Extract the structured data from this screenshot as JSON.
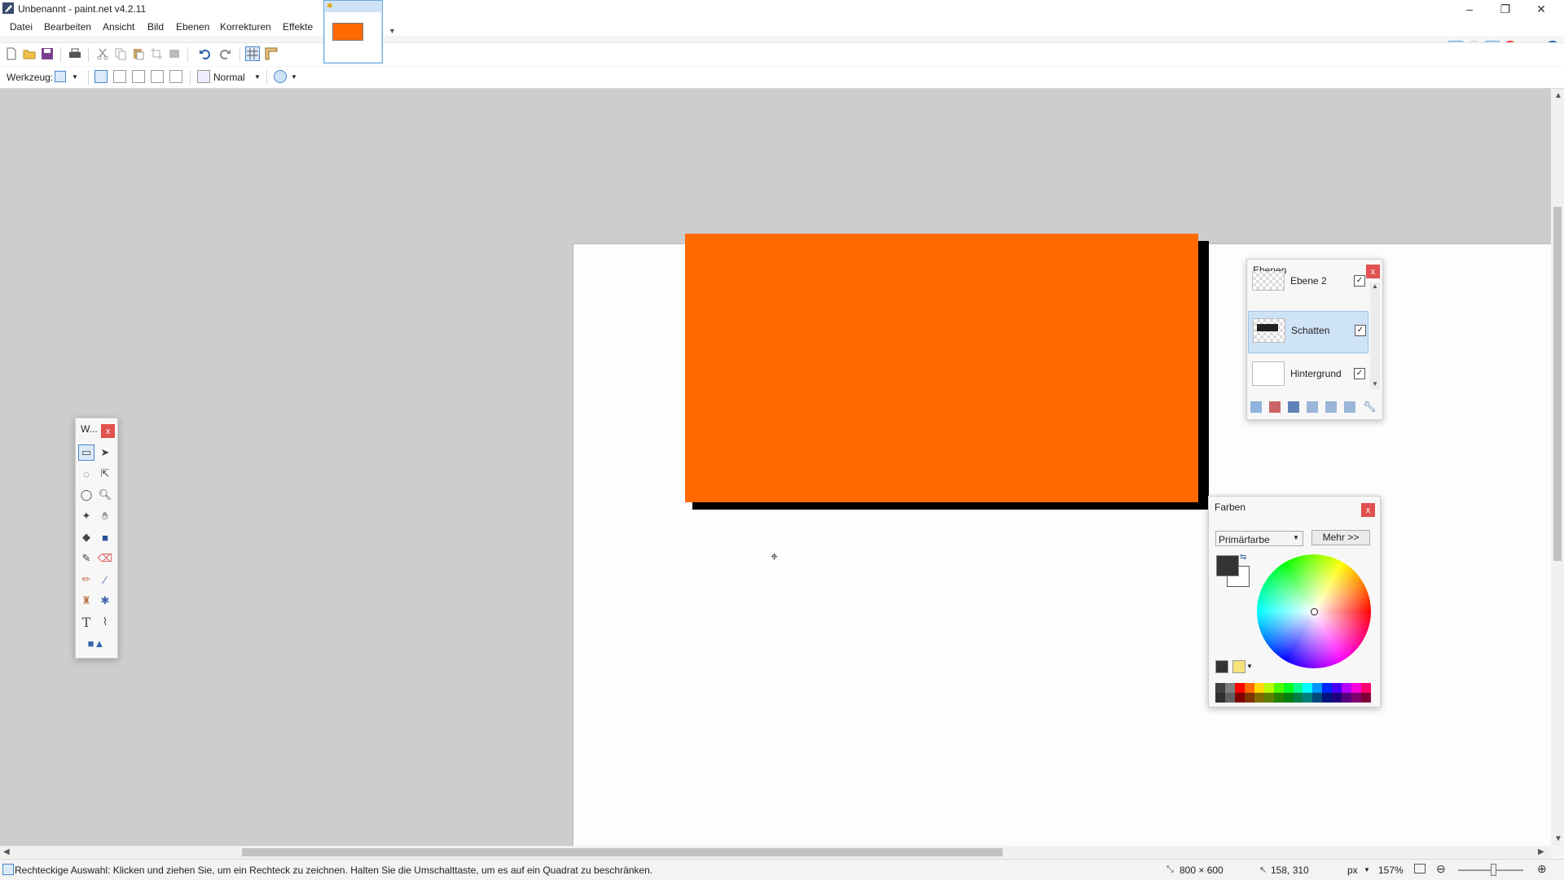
{
  "window": {
    "title": "Unbenannt - paint.net v4.2.11"
  },
  "menu": [
    "Datei",
    "Bearbeiten",
    "Ansicht",
    "Bild",
    "Ebenen",
    "Korrekturen",
    "Effekte"
  ],
  "toolbar2": {
    "tool_label": "Werkzeug:",
    "blend_mode": "Normal"
  },
  "canvas": {
    "shape_color": "#ff6a00",
    "shadow_color": "#000000"
  },
  "tools_window": {
    "title": "W...",
    "close": "x"
  },
  "layers_window": {
    "title": "Ebenen",
    "close": "x",
    "layers": [
      {
        "name": "Ebene 2",
        "visible": true,
        "selected": false
      },
      {
        "name": "Schatten",
        "visible": true,
        "selected": true
      },
      {
        "name": "Hintergrund",
        "visible": true,
        "selected": false
      }
    ]
  },
  "colors_window": {
    "title": "Farben",
    "close": "x",
    "mode": "Primärfarbe",
    "more_button": "Mehr >>",
    "primary_color": "#333333",
    "secondary_color": "#ffffff"
  },
  "status": {
    "hint": "Rechteckige Auswahl: Klicken und ziehen Sie, um ein Rechteck zu zeichnen. Halten Sie die Umschalttaste, um es auf ein Quadrat zu beschränken.",
    "image_size": "800 × 600",
    "cursor_pos": "158, 310",
    "unit": "px",
    "zoom": "157%"
  }
}
